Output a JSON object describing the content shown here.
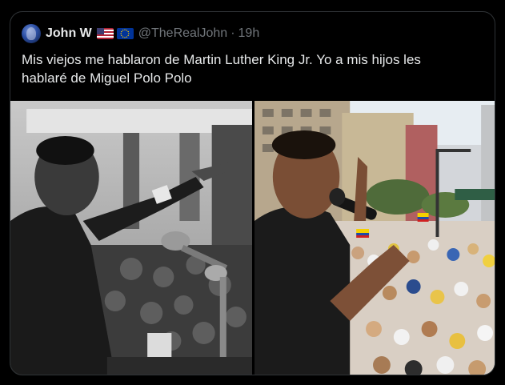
{
  "tweet": {
    "author_name": "John W",
    "flags": [
      "us-flag-icon",
      "eu-flag-icon"
    ],
    "handle": "@TheRealJohn",
    "separator": "·",
    "time": "19h",
    "text": "Mis viejos me hablaron de Martin Luther King Jr. Yo a mis hijos les hablaré de Miguel Polo Polo"
  },
  "media": {
    "left_photo": "black-and-white-speaker-photo",
    "right_photo": "color-rally-speaker-photo"
  },
  "colors": {
    "background": "#000000",
    "text": "#e7e9ea",
    "muted": "#71767b",
    "border": "#2f3336"
  }
}
